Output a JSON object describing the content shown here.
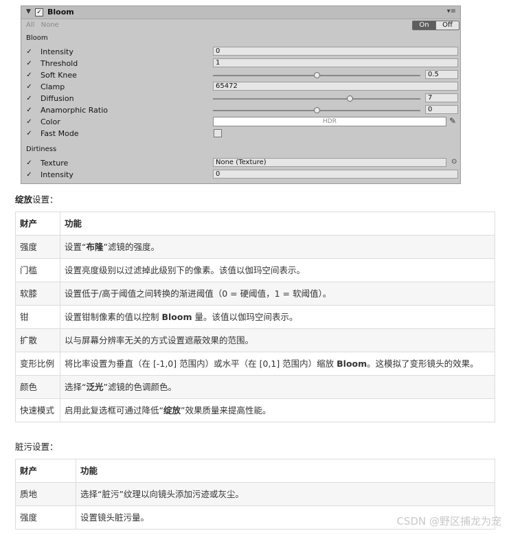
{
  "inspector": {
    "title": "Bloom",
    "all_label": "All",
    "none_label": "None",
    "on_label": "On",
    "off_label": "Off",
    "bloom_section": "Bloom",
    "dirtiness_section": "Dirtiness",
    "rows": [
      {
        "label": "Intensity",
        "value": "0"
      },
      {
        "label": "Threshold",
        "value": "1"
      },
      {
        "label": "Soft Knee",
        "value": "0.5",
        "slider": 0.5
      },
      {
        "label": "Clamp",
        "value": "65472"
      },
      {
        "label": "Diffusion",
        "value": "7",
        "slider": 0.66
      },
      {
        "label": "Anamorphic Ratio",
        "value": "0",
        "slider": 0.5
      },
      {
        "label": "Color",
        "value": "HDR"
      },
      {
        "label": "Fast Mode",
        "value": ""
      }
    ],
    "dirt_rows": [
      {
        "label": "Texture",
        "value": "None (Texture)"
      },
      {
        "label": "Intensity",
        "value": "0"
      }
    ]
  },
  "bloom_heading": {
    "bold": "绽放",
    "rest": "设置："
  },
  "bloom_table": {
    "headers": [
      "财产",
      "功能"
    ],
    "rows": [
      [
        "强度",
        "设置“布隆”滤镜的强度。"
      ],
      [
        "门槛",
        "设置亮度级别以过滤掉此级别下的像素。该值以伽玛空间表示。"
      ],
      [
        "软膝",
        "设置低于/高于阈值之间转换的渐进阈值（0 = 硬阈值，1 = 软阈值）。"
      ],
      [
        "钳",
        "设置钳制像素的值以控制 Bloom 量。该值以伽玛空间表示。"
      ],
      [
        "扩散",
        "以与屏幕分辨率无关的方式设置遮蔽效果的范围。"
      ],
      [
        "变形比例",
        "将比率设置为垂直（在 [-1,0] 范围内）或水平（在 [0,1] 范围内）缩放 Bloom。这模拟了变形镜头的效果。"
      ],
      [
        "颜色",
        "选择“泛光”滤镜的色调颜色。"
      ],
      [
        "快速模式",
        "启用此复选框可通过降低“绽放”效果质量来提高性能。"
      ]
    ]
  },
  "dirt_heading": {
    "bold": "",
    "rest": "脏污设置："
  },
  "dirt_table": {
    "headers": [
      "财产",
      "功能"
    ],
    "rows": [
      [
        "质地",
        "选择“脏污”纹理以向镜头添加污迹或灰尘。"
      ],
      [
        "强度",
        "设置镜头脏污量。"
      ]
    ]
  },
  "watermark": "CSDN @野区捕龙为宠"
}
